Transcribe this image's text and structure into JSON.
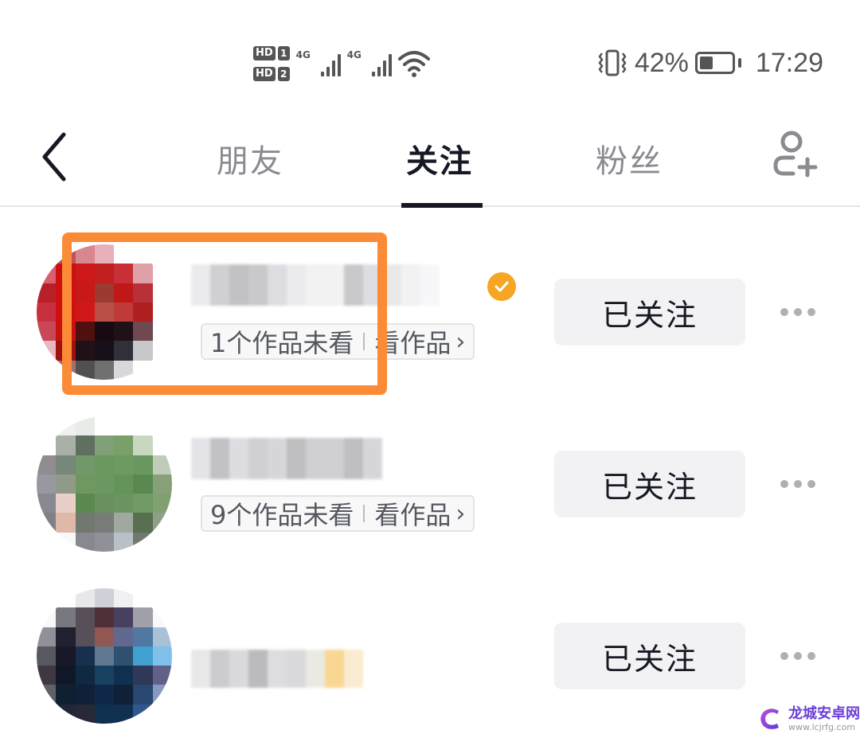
{
  "status_bar": {
    "sim1": "HD",
    "sim1_num": "1",
    "sim2": "HD",
    "sim2_num": "2",
    "network1": "4G",
    "network2": "4G",
    "battery_percent": "42%",
    "battery_level": 0.42,
    "time": "17:29",
    "icons": [
      "hd-1-icon",
      "hd-2-icon",
      "signal-4g-icon",
      "signal-4g-icon",
      "wifi-icon",
      "vibrate-icon",
      "battery-icon"
    ]
  },
  "header": {
    "back_icon": "chevron-left-icon",
    "tabs": [
      {
        "label": "朋友",
        "active": false
      },
      {
        "label": "关注",
        "active": true
      },
      {
        "label": "粉丝",
        "active": false
      }
    ],
    "add_user_icon": "add-user-icon"
  },
  "list": {
    "items": [
      {
        "name": "",
        "verified": true,
        "unwatched": "1个作品未看",
        "view_works": "看作品",
        "follow_label": "已关注",
        "highlighted": true
      },
      {
        "name": "",
        "verified": false,
        "unwatched": "9个作品未看",
        "view_works": "看作品",
        "follow_label": "已关注",
        "highlighted": false
      },
      {
        "name": "",
        "verified": false,
        "unwatched": "",
        "view_works": "",
        "follow_label": "已关注",
        "highlighted": false
      }
    ]
  },
  "colors": {
    "highlight": "#fb8b36",
    "verified": "#f5a623",
    "active_tab": "#161823",
    "inactive_tab": "#8a8b91",
    "button_bg": "#f2f2f4"
  },
  "watermark": {
    "title": "龙城安卓网",
    "url": "www.lcjrfg.com"
  }
}
